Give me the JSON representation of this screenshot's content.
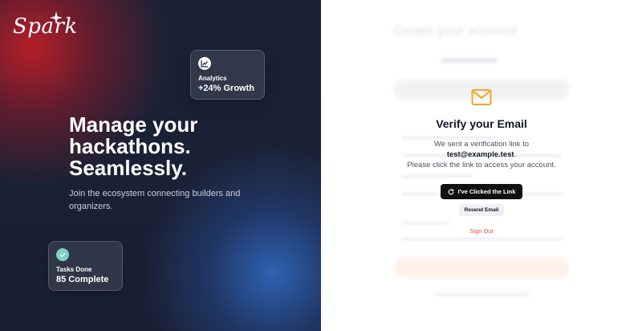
{
  "brand": {
    "name": "Spark"
  },
  "hero": {
    "headline_line1": "Manage your",
    "headline_line2": "hackathons.",
    "headline_line3": "Seamlessly.",
    "subline": "Join the ecosystem connecting builders and organizers."
  },
  "cards": {
    "analytics": {
      "label": "Analytics",
      "value": "+24% Growth",
      "icon": "chart-icon"
    },
    "tasks": {
      "label": "Tasks Done",
      "value": "85 Complete",
      "icon": "check-icon"
    }
  },
  "background_form": {
    "title": "Create your account"
  },
  "verify": {
    "icon": "mail-icon",
    "title": "Verify your Email",
    "text_before": "We sent a verification link to",
    "email": "test@example.test",
    "text_after": "Please click the link to access your account.",
    "primary_button": "I've Clicked the Link",
    "secondary_button": "Resend Email",
    "sign_out": "Sign Out"
  },
  "colors": {
    "hero_bg": "#1b2236",
    "accent_red": "#be1e28",
    "accent_blue": "#326ec8",
    "mail_icon": "#f5a524",
    "primary_button": "#111111",
    "sign_out": "#e3473e"
  }
}
